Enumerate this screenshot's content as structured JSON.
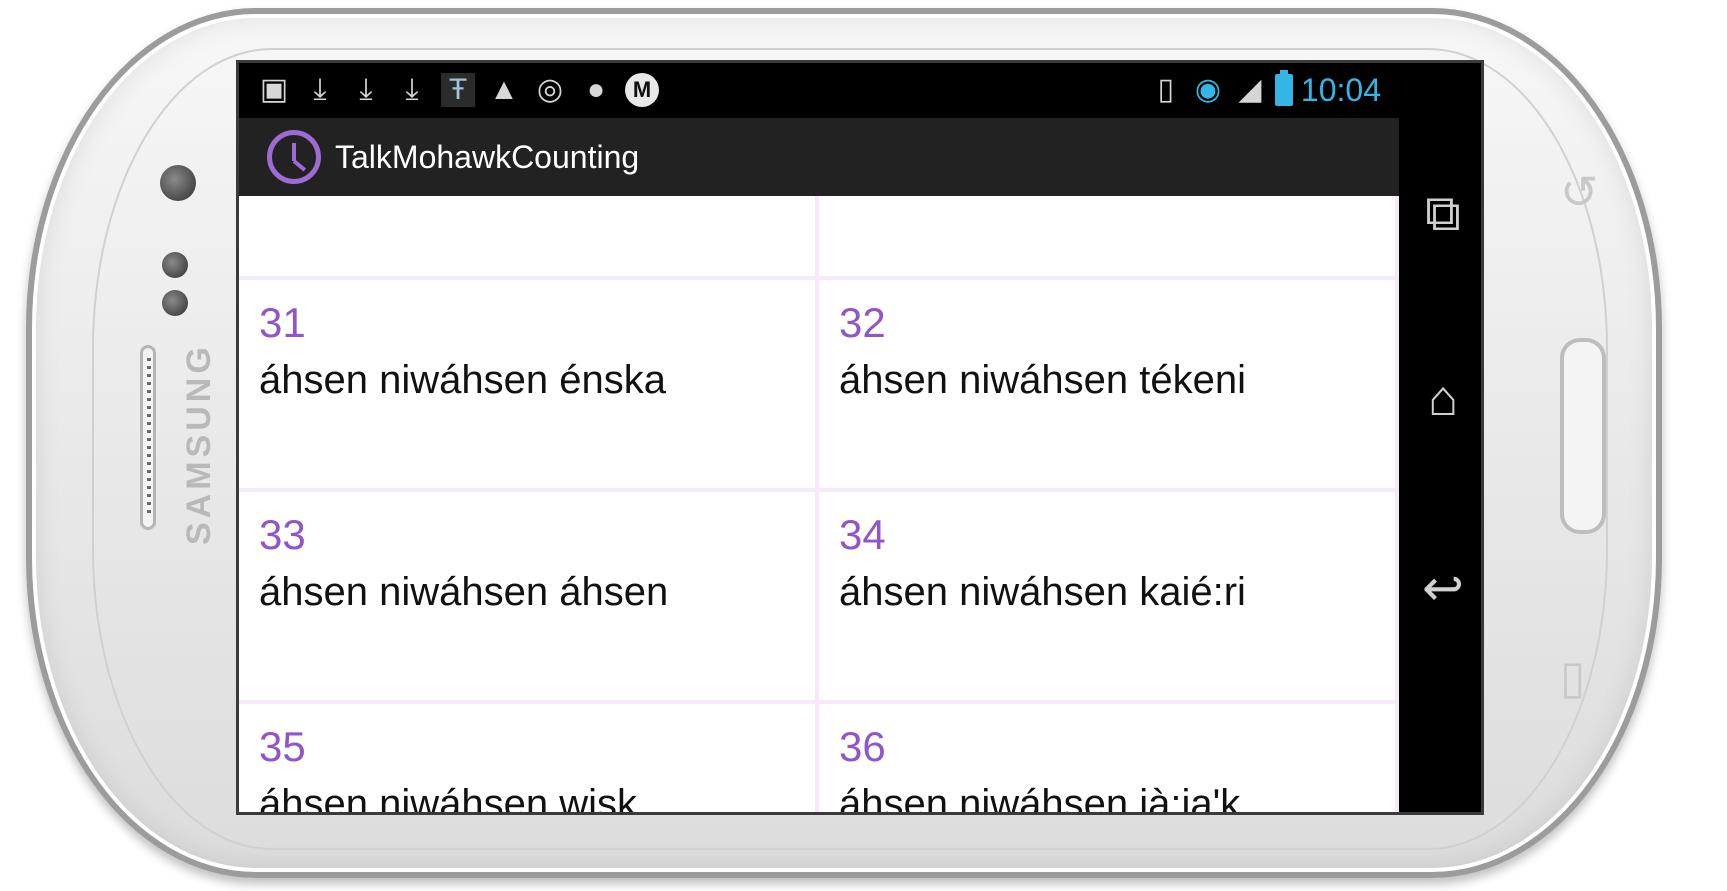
{
  "device": {
    "brand": "SAMSUNG"
  },
  "status_bar": {
    "notification_icons": [
      "image-icon",
      "download-icon",
      "download-icon",
      "download-icon",
      "text-icon",
      "ninja-icon",
      "target-icon",
      "android-icon",
      "m-logo-icon"
    ],
    "m_logo_text": "M",
    "time": "10:04",
    "accent_color": "#33b5e5"
  },
  "action_bar": {
    "app_title": "TalkMohawkCounting",
    "app_icon": "clock-icon",
    "accent_color": "#9e6ad3"
  },
  "grid": {
    "items": [
      {
        "number": "",
        "word": ""
      },
      {
        "number": "",
        "word": ""
      },
      {
        "number": "31",
        "word": "áhsen niwáhsen énska"
      },
      {
        "number": "32",
        "word": "áhsen niwáhsen tékeni"
      },
      {
        "number": "33",
        "word": "áhsen niwáhsen áhsen"
      },
      {
        "number": "34",
        "word": "áhsen niwáhsen kaié:ri"
      },
      {
        "number": "35",
        "word": "áhsen niwáhsen wisk"
      },
      {
        "number": "36",
        "word": "áhsen niwáhsen ià:ia'k"
      }
    ]
  },
  "nav_bar": {
    "recents_icon": "recents-icon",
    "home_icon": "home-icon",
    "back_icon": "back-icon"
  }
}
